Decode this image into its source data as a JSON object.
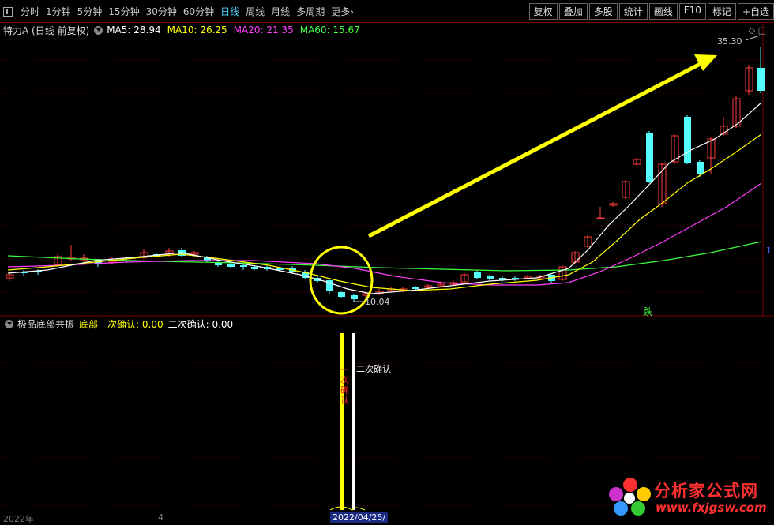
{
  "toolbar": {
    "periods": [
      {
        "label": "分时",
        "active": false
      },
      {
        "label": "1分钟",
        "active": false
      },
      {
        "label": "5分钟",
        "active": false
      },
      {
        "label": "15分钟",
        "active": false
      },
      {
        "label": "30分钟",
        "active": false
      },
      {
        "label": "60分钟",
        "active": false
      },
      {
        "label": "日线",
        "active": true
      },
      {
        "label": "周线",
        "active": false
      },
      {
        "label": "月线",
        "active": false
      },
      {
        "label": "多周期",
        "active": false
      },
      {
        "label": "更多›",
        "active": false
      }
    ],
    "right_buttons": [
      "复权",
      "叠加",
      "多股",
      "统计",
      "画线",
      "F10",
      "标记",
      "+自选"
    ]
  },
  "info": {
    "title": "特力A (日线 前复权)",
    "ma": [
      {
        "label": "MA5: 28.94",
        "color": "#ffffff"
      },
      {
        "label": "MA10: 26.25",
        "color": "#ffff00"
      },
      {
        "label": "MA20: 21.35",
        "color": "#ff40ff"
      },
      {
        "label": "MA60: 15.67",
        "color": "#40ff40"
      }
    ]
  },
  "price_labels": {
    "high": "35.30",
    "low": "10.04",
    "edge": "1"
  },
  "markers": {
    "die": "跌"
  },
  "indicator": {
    "name": "极品底部共振",
    "first_label": "底部一次确认: 0.00",
    "second_label": "二次确认: 0.00",
    "first_vertical": "一次确认",
    "second_text": "二次确认"
  },
  "bottom": {
    "left_date": "2022年",
    "mark": "4",
    "selected_date": "2022/04/25/"
  },
  "logo": {
    "cn": "分析家公式网",
    "url": "www.fxjgsw.com"
  },
  "colors": {
    "up": "#ff3c3c",
    "down": "#54ffff",
    "ma5": "#ffffff",
    "ma10": "#ffff00",
    "ma20": "#ff40ff",
    "ma60": "#40ff40",
    "annotation": "#ffff00"
  }
}
